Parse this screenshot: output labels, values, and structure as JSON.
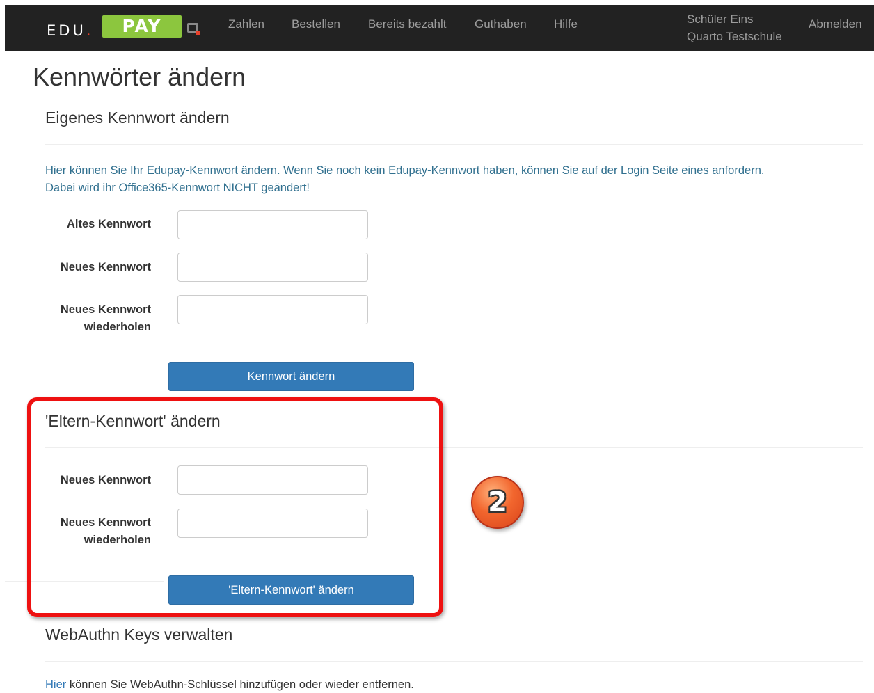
{
  "navbar": {
    "logo": {
      "part1": "EDU",
      "dot": ".",
      "part2": "PAY"
    },
    "links": [
      "Zahlen",
      "Bestellen",
      "Bereits bezahlt",
      "Guthaben",
      "Hilfe"
    ],
    "user_name": "Schüler Eins",
    "school": "Quarto Testschule",
    "logout": "Abmelden"
  },
  "page_title": "Kennwörter ändern",
  "own_password": {
    "title": "Eigenes Kennwort ändern",
    "info_line1": "Hier können Sie Ihr Edupay-Kennwort ändern. Wenn Sie noch kein Edupay-Kennwort haben, können Sie auf der Login Seite eines anfordern.",
    "info_line2": "Dabei wird ihr Office365-Kennwort NICHT geändert!",
    "old_label": "Altes Kennwort",
    "new_label": "Neues Kennwort",
    "repeat_label_1": "Neues Kennwort",
    "repeat_label_2": "wiederholen",
    "button": "Kennwort ändern"
  },
  "parent_password": {
    "title": "'Eltern-Kennwort' ändern",
    "new_label": "Neues Kennwort",
    "repeat_label_1": "Neues Kennwort",
    "repeat_label_2": "wiederholen",
    "button": "'Eltern-Kennwort' ändern"
  },
  "annotation": {
    "badge": "2",
    "color": "#ee1111"
  },
  "webauthn": {
    "title": "WebAuthn Keys verwalten",
    "link": "Hier",
    "text": " können Sie WebAuthn-Schlüssel hinzufügen oder wieder entfernen."
  },
  "colors": {
    "navbar": "#222222",
    "primary": "#337ab7",
    "info": "#31708f",
    "logo_green": "#8cc63e"
  }
}
